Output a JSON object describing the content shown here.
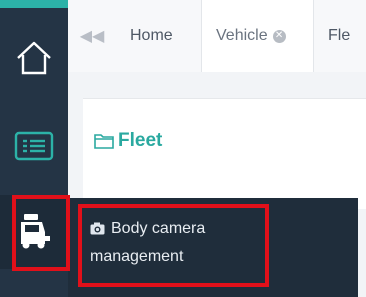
{
  "colors": {
    "sidebar_bg": "#243445",
    "accent": "#2cb2a8",
    "highlight": "#e1101a",
    "submenu_bg": "#1f2d3b"
  },
  "sidebar": {
    "items": [
      {
        "icon": "home-icon"
      },
      {
        "icon": "list-icon"
      },
      {
        "icon": "vehicle-icon"
      }
    ]
  },
  "tabs": {
    "back_icon": "double-chevron-left-icon",
    "items": [
      {
        "label": "Home"
      },
      {
        "label": "Vehicle",
        "closable": true
      },
      {
        "label": "Fle"
      }
    ]
  },
  "main": {
    "panel_title": "Fleet",
    "panel_icon": "folder-icon"
  },
  "submenu": {
    "items": [
      {
        "label": "Body camera management",
        "icon": "camera-icon"
      }
    ]
  }
}
